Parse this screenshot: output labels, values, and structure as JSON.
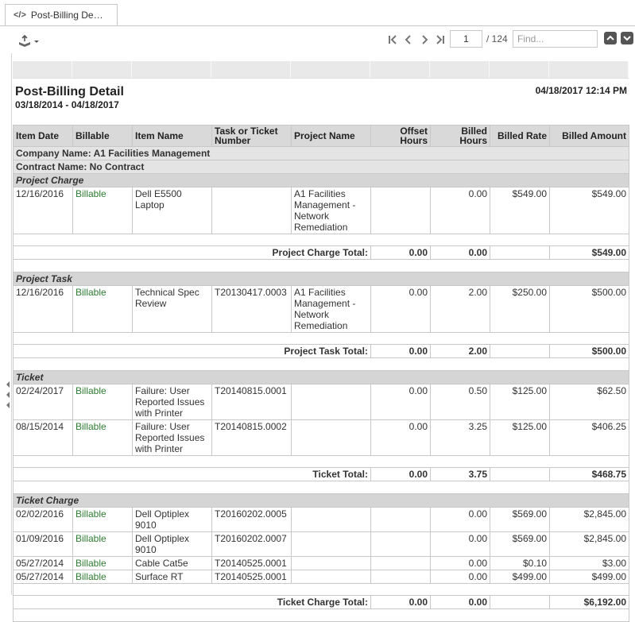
{
  "tab": {
    "icon": "code-icon",
    "label": "Post-Billing De…"
  },
  "toolbar": {
    "page_value": "1",
    "page_total": "/ 124",
    "find_placeholder": "Find..."
  },
  "report": {
    "title": "Post-Billing Detail",
    "date_range": "03/18/2014 - 04/18/2017",
    "printed": "04/18/2017 12:14 PM",
    "columns": {
      "item_date": "Item Date",
      "billable": "Billable",
      "item_name": "Item Name",
      "task_number": "Task or Ticket Number",
      "project_name": "Project Name",
      "offset_hours": "Offset Hours",
      "billed_hours": "Billed Hours",
      "billed_rate": "Billed Rate",
      "billed_amount": "Billed Amount"
    },
    "company": "Company Name: A1 Facilities Management",
    "contract": "Contract Name: No Contract",
    "sections": [
      {
        "name": "Project Charge",
        "rows": [
          {
            "date": "12/16/2016",
            "billable": "Billable",
            "item": "Dell E5500 Laptop",
            "task": "",
            "project": "A1 Facilities Management - Network Remediation",
            "offset": "",
            "hours": "0.00",
            "rate": "$549.00",
            "amount": "$549.00"
          }
        ],
        "total_label": "Project Charge Total:",
        "total_offset": "0.00",
        "total_hours": "0.00",
        "total_amount": "$549.00"
      },
      {
        "name": "Project Task",
        "rows": [
          {
            "date": "12/16/2016",
            "billable": "Billable",
            "item": "Technical Spec Review",
            "task": "T20130417.0003",
            "project": "A1 Facilities Management - Network Remediation",
            "offset": "0.00",
            "hours": "2.00",
            "rate": "$250.00",
            "amount": "$500.00"
          }
        ],
        "total_label": "Project Task Total:",
        "total_offset": "0.00",
        "total_hours": "2.00",
        "total_amount": "$500.00"
      },
      {
        "name": "Ticket",
        "rows": [
          {
            "date": "02/24/2017",
            "billable": "Billable",
            "item": "Failure: User Reported Issues with Printer",
            "task": "T20140815.0001",
            "project": "",
            "offset": "0.00",
            "hours": "0.50",
            "rate": "$125.00",
            "amount": "$62.50"
          },
          {
            "date": "08/15/2014",
            "billable": "Billable",
            "item": "Failure: User Reported Issues with Printer",
            "task": "T20140815.0002",
            "project": "",
            "offset": "0.00",
            "hours": "3.25",
            "rate": "$125.00",
            "amount": "$406.25"
          }
        ],
        "total_label": "Ticket Total:",
        "total_offset": "0.00",
        "total_hours": "3.75",
        "total_amount": "$468.75"
      },
      {
        "name": "Ticket Charge",
        "rows": [
          {
            "date": "02/02/2016",
            "billable": "Billable",
            "item": "Dell Optiplex 9010",
            "task": "T20160202.0005",
            "project": "",
            "offset": "",
            "hours": "0.00",
            "rate": "$569.00",
            "amount": "$2,845.00"
          },
          {
            "date": "01/09/2016",
            "billable": "Billable",
            "item": "Dell Optiplex 9010",
            "task": "T20160202.0007",
            "project": "",
            "offset": "",
            "hours": "0.00",
            "rate": "$569.00",
            "amount": "$2,845.00"
          },
          {
            "date": "05/27/2014",
            "billable": "Billable",
            "item": "Cable Cat5e",
            "task": "T20140525.0001",
            "project": "",
            "offset": "",
            "hours": "0.00",
            "rate": "$0.10",
            "amount": "$3.00"
          },
          {
            "date": "05/27/2014",
            "billable": "Billable",
            "item": "Surface RT",
            "task": "T20140525.0001",
            "project": "",
            "offset": "",
            "hours": "0.00",
            "rate": "$499.00",
            "amount": "$499.00"
          }
        ],
        "total_label": "Ticket Charge Total:",
        "total_offset": "0.00",
        "total_hours": "0.00",
        "total_amount": "$6,192.00"
      }
    ]
  }
}
